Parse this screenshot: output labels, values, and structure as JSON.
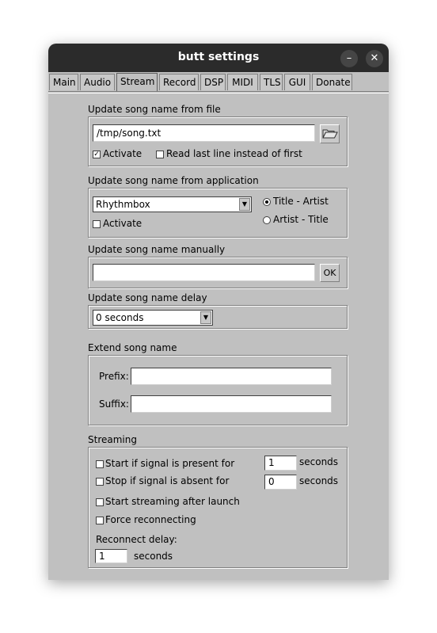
{
  "window": {
    "title": "butt settings",
    "minimize_icon": "minimize-icon",
    "close_icon": "close-icon"
  },
  "tabs": [
    "Main",
    "Audio",
    "Stream",
    "Record",
    "DSP",
    "MIDI",
    "TLS",
    "GUI",
    "Donate"
  ],
  "active_tab": "Stream",
  "file_section": {
    "label": "Update song name from file",
    "path_value": "/tmp/song.txt",
    "browse_icon": "folder-open-icon",
    "activate_label": "Activate",
    "activate_checked": true,
    "read_last_label": "Read last line instead of first",
    "read_last_checked": false
  },
  "app_section": {
    "label": "Update song name from application",
    "app_value": "Rhythmbox",
    "activate_label": "Activate",
    "activate_checked": false,
    "order_options": [
      "Title - Artist",
      "Artist - Title"
    ],
    "order_selected": "Title - Artist"
  },
  "manual_section": {
    "label": "Update song name manually",
    "value": "",
    "ok_label": "OK"
  },
  "delay_section": {
    "label": "Update song name delay",
    "value": "0 seconds"
  },
  "extend_section": {
    "label": "Extend song name",
    "prefix_label": "Prefix:",
    "prefix_value": "",
    "suffix_label": "Suffix:",
    "suffix_value": ""
  },
  "streaming_section": {
    "label": "Streaming",
    "start_signal_label": "Start if signal is present for",
    "start_signal_value": "1",
    "stop_signal_label": "Stop if signal is absent for",
    "stop_signal_value": "0",
    "seconds_label": "seconds",
    "start_after_launch_label": "Start streaming after launch",
    "force_reconnect_label": "Force reconnecting",
    "reconnect_delay_label": "Reconnect delay:",
    "reconnect_delay_value": "1"
  }
}
